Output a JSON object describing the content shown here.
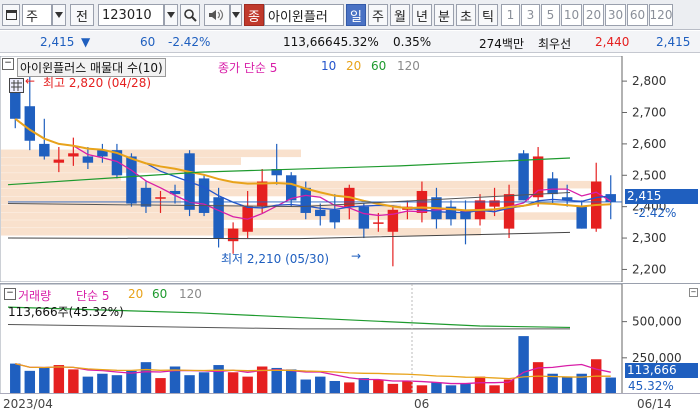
{
  "toolbar": {
    "window_icon": "window-icon",
    "market": "주",
    "market_alt": "전",
    "code": "123010",
    "search_icon": "search-icon",
    "sound_icon": "speaker-icon",
    "jong": "종",
    "stock_name": "아이윈플러",
    "periods": [
      "일",
      "주",
      "월",
      "년",
      "분",
      "초",
      "틱"
    ],
    "selected_period": "일",
    "numbers": [
      "1",
      "3",
      "5",
      "10",
      "20",
      "30",
      "60",
      "120"
    ]
  },
  "quote": {
    "price": "2,415",
    "change": "60",
    "change_pct": "-2.42%",
    "volume": "113,666",
    "volume_rate": "45.32%",
    "turnover": "0.35%",
    "amount": "274백만",
    "best_label": "최우선",
    "bid": "2,440",
    "ask": "2,415"
  },
  "price_pane": {
    "legend_name": "아이윈플러스 매물대 수(10)",
    "legend_ma": "종가 단순 5",
    "ma_periods": [
      "10",
      "20",
      "60",
      "120"
    ],
    "high_label": "최고 2,820 (04/28)",
    "low_label": "최저 2,210 (05/30)",
    "current_price": "2,415",
    "current_pct": "-2.42%"
  },
  "volume_pane": {
    "legend": "거래량",
    "legend_ma": "단순 5",
    "ma_periods": [
      "20",
      "60",
      "120"
    ],
    "last_text": "113,666주(45.32%)",
    "current_volume": "113,666",
    "current_pct": "45.32%"
  },
  "x_labels": {
    "left": "2023/04",
    "mid": "06",
    "right": "06/14"
  },
  "colors": {
    "up": "#e52020",
    "down": "#1f5fbf",
    "ma5": "#d81ea8",
    "ma10": "#2455cc",
    "ma20": "#e8a31b",
    "ma60": "#1e9a2e",
    "ma120": "#8a8a8a",
    "volume_profile": "#f8dcc4"
  },
  "chart_data": {
    "type": "candlestick",
    "y_ticks": [
      2200,
      2300,
      2400,
      2500,
      2600,
      2700,
      2800
    ],
    "ylim": [
      2160,
      2880
    ],
    "candles": [
      [
        2780,
        2790,
        2650,
        2680
      ],
      [
        2720,
        2820,
        2580,
        2610
      ],
      [
        2600,
        2680,
        2550,
        2560
      ],
      [
        2540,
        2590,
        2510,
        2550
      ],
      [
        2560,
        2620,
        2530,
        2570
      ],
      [
        2560,
        2590,
        2520,
        2540
      ],
      [
        2580,
        2600,
        2540,
        2560
      ],
      [
        2580,
        2600,
        2490,
        2500
      ],
      [
        2560,
        2570,
        2400,
        2410
      ],
      [
        2460,
        2480,
        2380,
        2400
      ],
      [
        2430,
        2450,
        2380,
        2430
      ],
      [
        2450,
        2470,
        2410,
        2440
      ],
      [
        2570,
        2580,
        2370,
        2390
      ],
      [
        2490,
        2500,
        2370,
        2380
      ],
      [
        2430,
        2460,
        2270,
        2300
      ],
      [
        2290,
        2350,
        2250,
        2330
      ],
      [
        2320,
        2450,
        2300,
        2400
      ],
      [
        2400,
        2520,
        2380,
        2480
      ],
      [
        2520,
        2600,
        2470,
        2500
      ],
      [
        2500,
        2510,
        2400,
        2420
      ],
      [
        2460,
        2480,
        2360,
        2380
      ],
      [
        2390,
        2410,
        2340,
        2370
      ],
      [
        2390,
        2440,
        2330,
        2350
      ],
      [
        2400,
        2470,
        2360,
        2460
      ],
      [
        2400,
        2410,
        2300,
        2330
      ],
      [
        2350,
        2380,
        2320,
        2350
      ],
      [
        2320,
        2400,
        2210,
        2390
      ],
      [
        2390,
        2420,
        2360,
        2400
      ],
      [
        2380,
        2480,
        2350,
        2450
      ],
      [
        2430,
        2460,
        2330,
        2360
      ],
      [
        2400,
        2420,
        2340,
        2360
      ],
      [
        2390,
        2420,
        2280,
        2360
      ],
      [
        2360,
        2440,
        2340,
        2420
      ],
      [
        2400,
        2460,
        2370,
        2420
      ],
      [
        2330,
        2470,
        2300,
        2440
      ],
      [
        2570,
        2580,
        2420,
        2420
      ],
      [
        2430,
        2590,
        2400,
        2560
      ],
      [
        2490,
        2510,
        2410,
        2440
      ],
      [
        2430,
        2470,
        2400,
        2420
      ],
      [
        2400,
        2420,
        2330,
        2330
      ],
      [
        2330,
        2540,
        2320,
        2480
      ],
      [
        2440,
        2500,
        2360,
        2415
      ]
    ],
    "volume_ylim": [
      0,
      760000
    ],
    "volume_ticks": [
      250000,
      500000
    ],
    "volumes": [
      210000,
      160000,
      180000,
      200000,
      170000,
      120000,
      140000,
      130000,
      160000,
      220000,
      110000,
      190000,
      130000,
      150000,
      200000,
      150000,
      120000,
      190000,
      180000,
      170000,
      100000,
      120000,
      90000,
      80000,
      110000,
      100000,
      70000,
      90000,
      60000,
      80000,
      60000,
      70000,
      120000,
      60000,
      100000,
      400000,
      220000,
      140000,
      120000,
      140000,
      240000,
      113666
    ]
  }
}
